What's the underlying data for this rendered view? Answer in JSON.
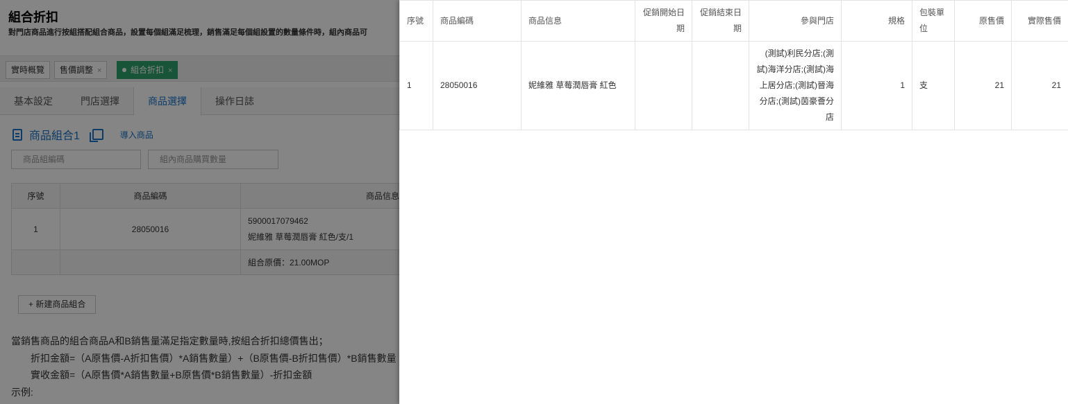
{
  "page": {
    "title": "組合折扣",
    "description": "對門店商品進行按組搭配組合商品，設置每個組滿足梳理，銷售滿足每個組設置的數量條件時，組內商品可"
  },
  "open_tabs": [
    {
      "label": "實時概覽",
      "closable": false,
      "active": false
    },
    {
      "label": "售價調整",
      "closable": true,
      "active": false
    },
    {
      "label": "組合折扣",
      "closable": true,
      "active": true
    }
  ],
  "close_glyph": "×",
  "sub_tabs": [
    "基本設定",
    "門店選擇",
    "商品選擇",
    "操作日誌"
  ],
  "sub_tab_active": "商品選擇",
  "group": {
    "title": "商品組合1",
    "import_label": "導入商品",
    "code_placeholder": "商品組編碼",
    "qty_placeholder": "組內商品購買數量",
    "headers": [
      "序號",
      "商品編碼",
      "商品信息"
    ],
    "row": {
      "index": "1",
      "code": "28050016",
      "barcode": "5900017079462",
      "info": "妮維雅 草莓潤唇膏 紅色/支/1"
    },
    "total": "組合原價：21.00MOP"
  },
  "new_group_label": "+ 新建商品組合",
  "rules": [
    "當銷售商品的組合商品A和B銷售量滿足指定數量時,按組合折扣總價售出；",
    "折扣金額=（A原售價-A折扣售價）*A銷售數量）+（B原售價-B折扣售價）*B銷售數量",
    "實收金額=（A原售價*A銷售數量+B原售價*B銷售數量）-折扣金額",
    "示例:"
  ],
  "drawer": {
    "headers": [
      "序號",
      "商品編碼",
      "商品信息",
      "促銷開始日期",
      "促銷結束日期",
      "參與門店",
      "規格",
      "包裝單位",
      "原售價",
      "實際售價"
    ],
    "rows": [
      {
        "index": "1",
        "code": "28050016",
        "info": "妮維雅 草莓潤唇膏 紅色",
        "start_date": "",
        "end_date": "",
        "stores": "(測試)利民分店;(測試)海洋分店;(測試)海上居分店;(測試)晉海分店;(測試)茵豪薈分店",
        "spec": "1",
        "unit": "支",
        "original_price": "21",
        "actual_price": "21"
      }
    ]
  },
  "colors": {
    "accent": "#1a73c8",
    "active_tab": "#2ea26a",
    "overlay": "rgba(0,0,0,0.48)"
  }
}
